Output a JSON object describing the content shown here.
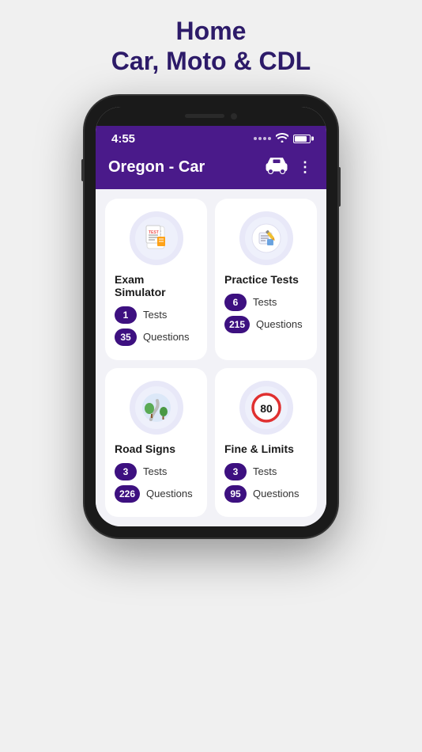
{
  "page": {
    "title_line1": "Home",
    "title_line2": "Car, Moto & CDL"
  },
  "status_bar": {
    "time": "4:55"
  },
  "header": {
    "title": "Oregon - Car"
  },
  "cards": [
    {
      "id": "exam-simulator",
      "title": "Exam Simulator",
      "stats": [
        {
          "count": "1",
          "label": "Tests"
        },
        {
          "count": "35",
          "label": "Questions"
        }
      ]
    },
    {
      "id": "practice-tests",
      "title": "Practice Tests",
      "stats": [
        {
          "count": "6",
          "label": "Tests"
        },
        {
          "count": "215",
          "label": "Questions"
        }
      ]
    },
    {
      "id": "road-signs",
      "title": "Road Signs",
      "stats": [
        {
          "count": "3",
          "label": "Tests"
        },
        {
          "count": "226",
          "label": "Questions"
        }
      ]
    },
    {
      "id": "fine-limits",
      "title": "Fine & Limits",
      "stats": [
        {
          "count": "3",
          "label": "Tests"
        },
        {
          "count": "95",
          "label": "Questions"
        }
      ]
    }
  ]
}
